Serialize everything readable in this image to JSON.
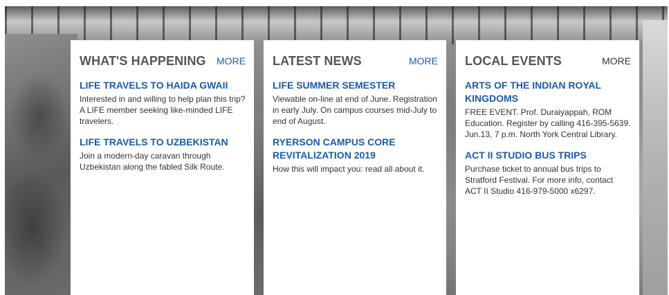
{
  "columns": [
    {
      "title": "WHAT'S HAPPENING",
      "more": "MORE",
      "items": [
        {
          "title": "LIFE TRAVELS TO HAIDA GWAII",
          "description": "Interested in and willing to help plan this trip? A LIFE member seeking like-minded LIFE travelers."
        },
        {
          "title": "LIFE TRAVELS TO UZBEKISTAN",
          "description": "Join a modern-day caravan through Uzbekistan along the fabled Silk Route."
        }
      ]
    },
    {
      "title": "LATEST NEWS",
      "more": "MORE",
      "items": [
        {
          "title": "LIFE SUMMER SEMESTER",
          "description": "Viewable on-line at end of June. Registration in early July. On campus courses mid-July to end of August."
        },
        {
          "title": "RYERSON CAMPUS CORE REVITALIZATION 2019",
          "description": "How this will impact you: read all about it."
        }
      ]
    },
    {
      "title": "LOCAL EVENTS",
      "more": "MORE",
      "items": [
        {
          "title": "ARTS OF THE INDIAN ROYAL KINGDOMS",
          "description": "FREE EVENT. Prof. Duraiyappah, ROM Education. Register by calling 416-395-5639. Jun.13, 7 p.m. North York Central Library."
        },
        {
          "title": "ACT II STUDIO BUS TRIPS",
          "description": "Purchase ticket to annual bus trips to Stratford Festival. For more info, contact ACT II Studio 416-979-5000 x6297."
        }
      ]
    }
  ],
  "colors": {
    "link": "#1a5ba6",
    "heading": "#555555",
    "body_text": "#333333"
  }
}
